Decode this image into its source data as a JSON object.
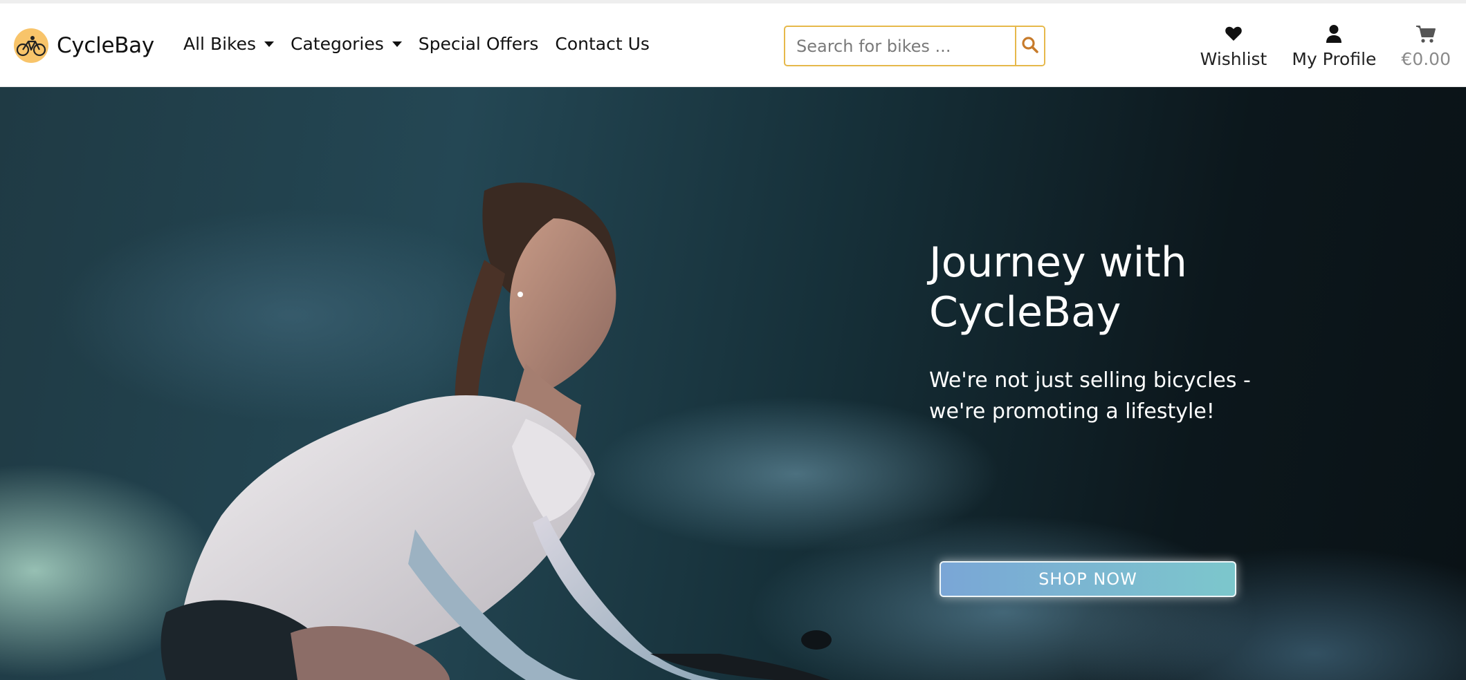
{
  "brand": {
    "name": "CycleBay",
    "logo_icon": "bicycle-icon",
    "logo_color": "#f8c46a"
  },
  "nav": {
    "items": [
      {
        "label": "All Bikes",
        "dropdown": true
      },
      {
        "label": "Categories",
        "dropdown": true
      },
      {
        "label": "Special Offers",
        "dropdown": false
      },
      {
        "label": "Contact Us",
        "dropdown": false
      }
    ]
  },
  "search": {
    "placeholder": "Search for bikes ...",
    "value": "",
    "button_icon": "search-icon",
    "accent_color": "#e6b84a",
    "icon_color": "#c77b2b"
  },
  "actions": {
    "wishlist_label": "Wishlist",
    "wishlist_icon": "heart-icon",
    "profile_label": "My Profile",
    "profile_icon": "user-icon",
    "cart_label": "€0.00",
    "cart_icon": "shopping-cart-icon"
  },
  "hero": {
    "title_line1": "Journey with",
    "title_line2": "CycleBay",
    "subtitle_line1": "We're not just selling bicycles -",
    "subtitle_line2": "we're promoting a lifestyle!",
    "cta_label": "SHOP NOW",
    "cta_colors": [
      "#7aa6d6",
      "#7cc7cc"
    ]
  }
}
